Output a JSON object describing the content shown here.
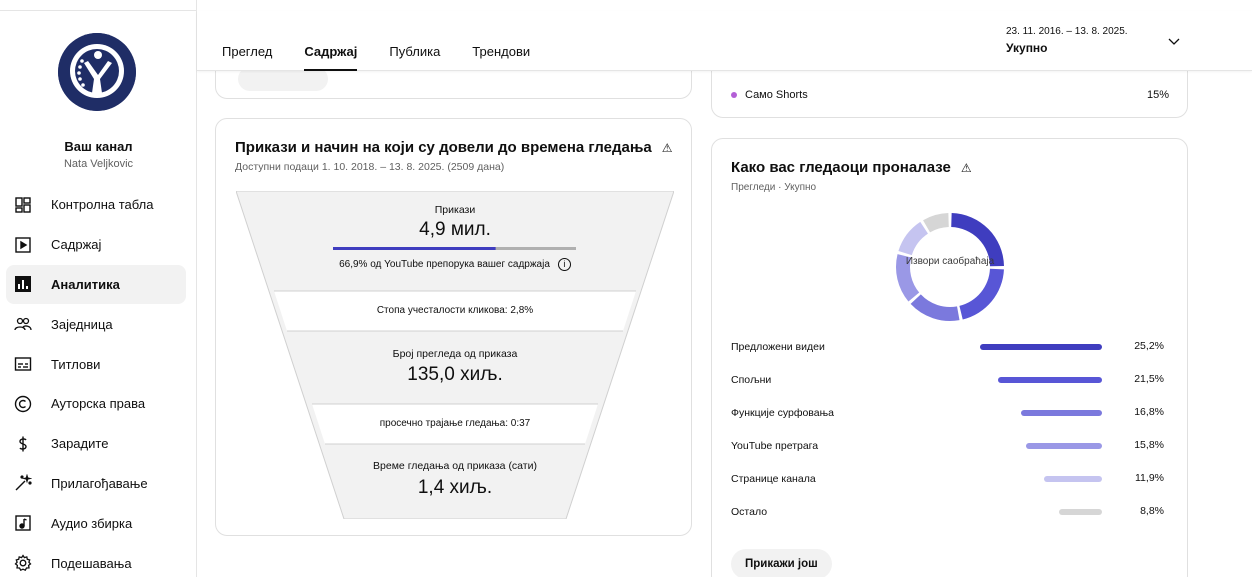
{
  "channel": {
    "title": "Ваш канал",
    "name": "Nata Veljkovic"
  },
  "sidebar": {
    "items": [
      {
        "label": "Контролна табла",
        "icon": "dashboard-icon"
      },
      {
        "label": "Садржај",
        "icon": "content-icon"
      },
      {
        "label": "Аналитика",
        "icon": "analytics-icon",
        "active": true
      },
      {
        "label": "Заједница",
        "icon": "community-icon"
      },
      {
        "label": "Титлови",
        "icon": "subtitles-icon"
      },
      {
        "label": "Ауторска права",
        "icon": "copyright-icon"
      },
      {
        "label": "Зарадите",
        "icon": "earn-icon"
      },
      {
        "label": "Прилагођавање",
        "icon": "customization-icon"
      },
      {
        "label": "Аудио збирка",
        "icon": "audio-library-icon"
      },
      {
        "label": "Подешавања",
        "icon": "settings-icon"
      }
    ]
  },
  "header": {
    "tabs": [
      "Преглед",
      "Садржај",
      "Публика",
      "Трендови"
    ],
    "active_tab": "Садржај",
    "date_range": "23. 11. 2016. – 13. 8. 2025.",
    "date_label": "Укупно"
  },
  "shorts_row": {
    "label": "Само Shorts",
    "value": "15%"
  },
  "funnel": {
    "title": "Прикази и начин на који су довели до времена гледања",
    "subtitle": "Доступни подаци 1. 10. 2018. – 13. 8. 2025. (2509 дана)",
    "impressions_label": "Прикази",
    "impressions_value": "4,9 мил.",
    "impressions_recommend_fraction": 0.669,
    "recommend_text": "66,9% од YouTube препорука вашег садржаја",
    "ctr_text": "Стопа учесталости кликова: 2,8%",
    "views_label": "Број прегледа од приказа",
    "views_value": "135,0 хиљ.",
    "avg_text": "просечно трајање гледања: 0:37",
    "watch_label": "Време гледања од приказа (сати)",
    "watch_value": "1,4 хиљ."
  },
  "traffic": {
    "title": "Како вас гледаоци проналазе",
    "subtitle": "Прегледи · Укупно",
    "donut_label": "Извори саобраћаја",
    "sources": [
      {
        "name": "Предложени видеи",
        "pct": "25,2%",
        "value": 25.2,
        "color": "#3f3dbf"
      },
      {
        "name": "Спољни",
        "pct": "21,5%",
        "value": 21.5,
        "color": "#5856d6"
      },
      {
        "name": "Функције сурфовања",
        "pct": "16,8%",
        "value": 16.8,
        "color": "#7b79dd"
      },
      {
        "name": "YouTube претрага",
        "pct": "15,8%",
        "value": 15.8,
        "color": "#9a98e6"
      },
      {
        "name": "Странице канала",
        "pct": "11,9%",
        "value": 11.9,
        "color": "#c5c4f0"
      },
      {
        "name": "Остало",
        "pct": "8,8%",
        "value": 8.8,
        "color": "#d6d6d6"
      }
    ],
    "more_button": "Прикажи још"
  }
}
